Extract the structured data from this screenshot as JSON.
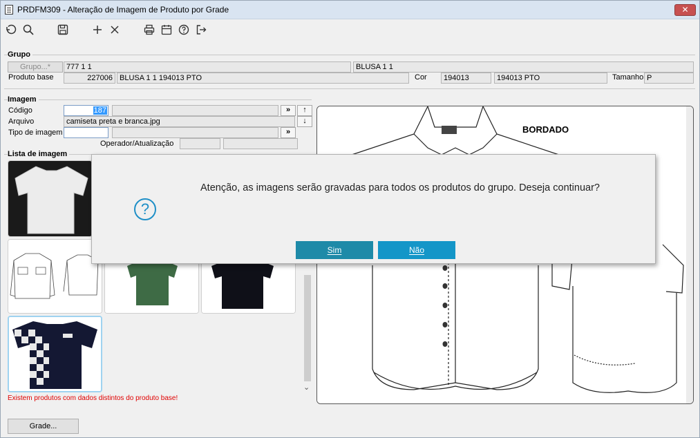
{
  "window": {
    "title": "PRDFM309 - Alteração de Imagem de Produto por Grade",
    "close_label": "✕"
  },
  "toolbar": {
    "icons": [
      "undo-icon",
      "search-icon",
      "save-icon",
      "add-icon",
      "delete-icon",
      "print-icon",
      "calendar-icon",
      "help-icon",
      "exit-icon"
    ]
  },
  "grupo": {
    "section_label": "Grupo",
    "grupo_button": "Grupo...*",
    "grupo_code": "777 1 1",
    "grupo_desc": "BLUSA 1 1",
    "produto_base_label": "Produto base",
    "produto_code": "227006",
    "produto_desc": "BLUSA 1 1 194013 PTO",
    "cor_label": "Cor",
    "cor_code": "194013",
    "cor_desc": "194013 PTO",
    "tamanho_label": "Tamanho",
    "tamanho_value": "P"
  },
  "imagem": {
    "section_label": "Imagem",
    "codigo_label": "Código",
    "codigo_value": "187",
    "arquivo_label": "Arquivo",
    "arquivo_value": "camiseta preta e branca.jpg",
    "tipo_label": "Tipo de imagem",
    "tipo_value": "",
    "operador_label": "Operador/Atualização",
    "btn_more": "»",
    "btn_up": "↑",
    "btn_down": "↓"
  },
  "lista": {
    "section_label": "Lista de imagem",
    "warning": "Existem produtos com dados distintos do produto base!"
  },
  "preview": {
    "label_text": "BORDADO"
  },
  "dialog": {
    "message": "Atenção, as imagens serão gravadas para todos os produtos do grupo. Deseja continuar?",
    "yes_label": "Sim",
    "no_label": "Não",
    "yes_color": "#1e8aa8",
    "no_color": "#1496c8",
    "icon": "question-icon"
  },
  "footer": {
    "grade_button": "Grade..."
  }
}
